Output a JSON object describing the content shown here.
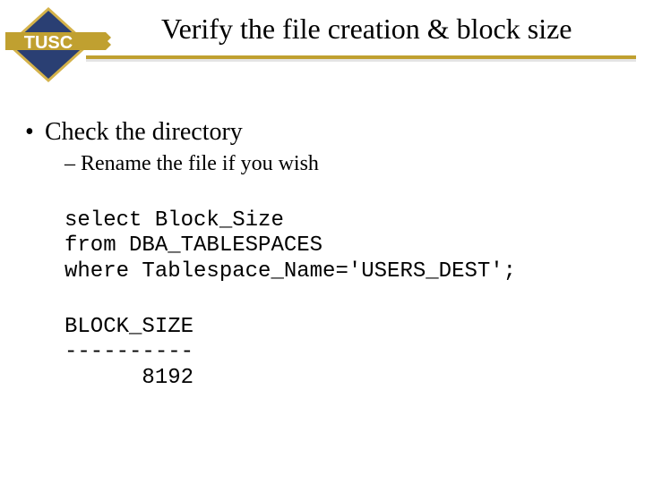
{
  "logo_text": "TUSC",
  "title": "Verify the file creation & block size",
  "bullets": {
    "lvl1": "Check the directory",
    "lvl2": "Rename the file if you wish"
  },
  "code": {
    "l1": "select Block_Size",
    "l2": "from DBA_TABLESPACES",
    "l3": "where Tablespace_Name='USERS_DEST';"
  },
  "output": {
    "h": "BLOCK_SIZE",
    "sep": "----------",
    "v": "      8192"
  }
}
